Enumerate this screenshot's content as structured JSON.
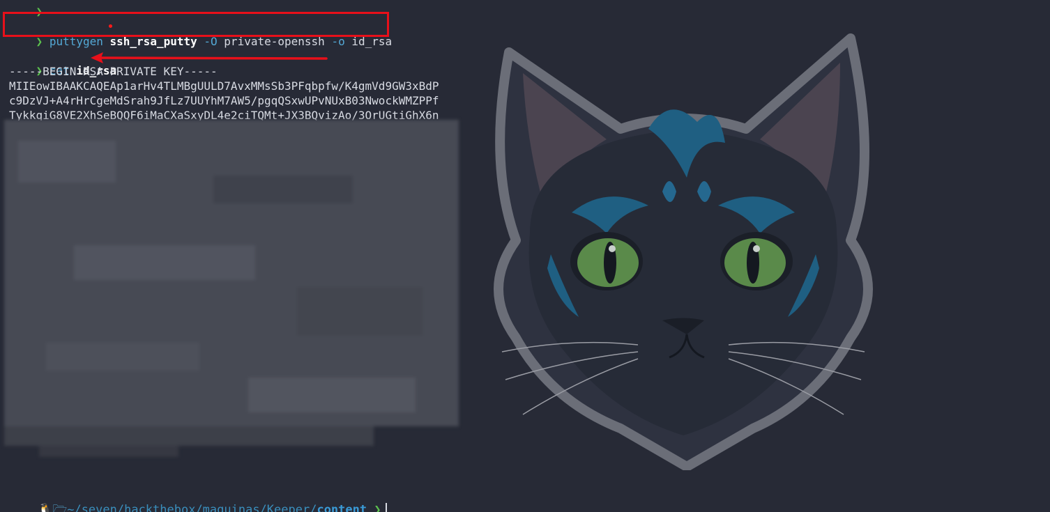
{
  "top_prompt_arrow": "❯",
  "command1": {
    "prompt": "❯",
    "program": "puttygen",
    "input_file": "ssh_rsa_putty",
    "flag_out_type": "-O",
    "out_type": "private-openssh",
    "flag_out_file": "-o",
    "out_file": "id_rsa"
  },
  "command2": {
    "prompt": "❯",
    "program": "cat",
    "arg": "id_rsa"
  },
  "output": {
    "header": "-----BEGIN RSA PRIVATE KEY-----",
    "lines": [
      "MIIEowIBAAKCAQEAp1arHv4TLMBgUULD7AvxMMsSb3PFqbpfw/K4gmVd9GW3xBdP",
      "c9DzVJ+A4rHrCgeMdSrah9JfLz7UUYhM7AW5/pgqQSxwUPvNUxB03NwockWMZPPf",
      "TykkqiG8VE2XhSeBQQF6iMaCXaSxyDL4e2ciTQMt+JX3BQvizAo/3OrUGtiGhX6n"
    ],
    "redacted": "blurred"
  },
  "bottom_prompt": {
    "os_icon": "🐧",
    "folder_icon": "🗁",
    "path_prefix": "~/seven/hackthebox/maquinas/Keeper/",
    "path_current": "content",
    "prompt": "❯"
  },
  "colors": {
    "background": "#272a36",
    "prompt_green": "#5cc24e",
    "command_blue": "#54a9d6",
    "highlight_red": "#e8101a"
  },
  "icons": [
    "tux-icon",
    "folder-icon",
    "arrow-icon",
    "cat-logo"
  ]
}
